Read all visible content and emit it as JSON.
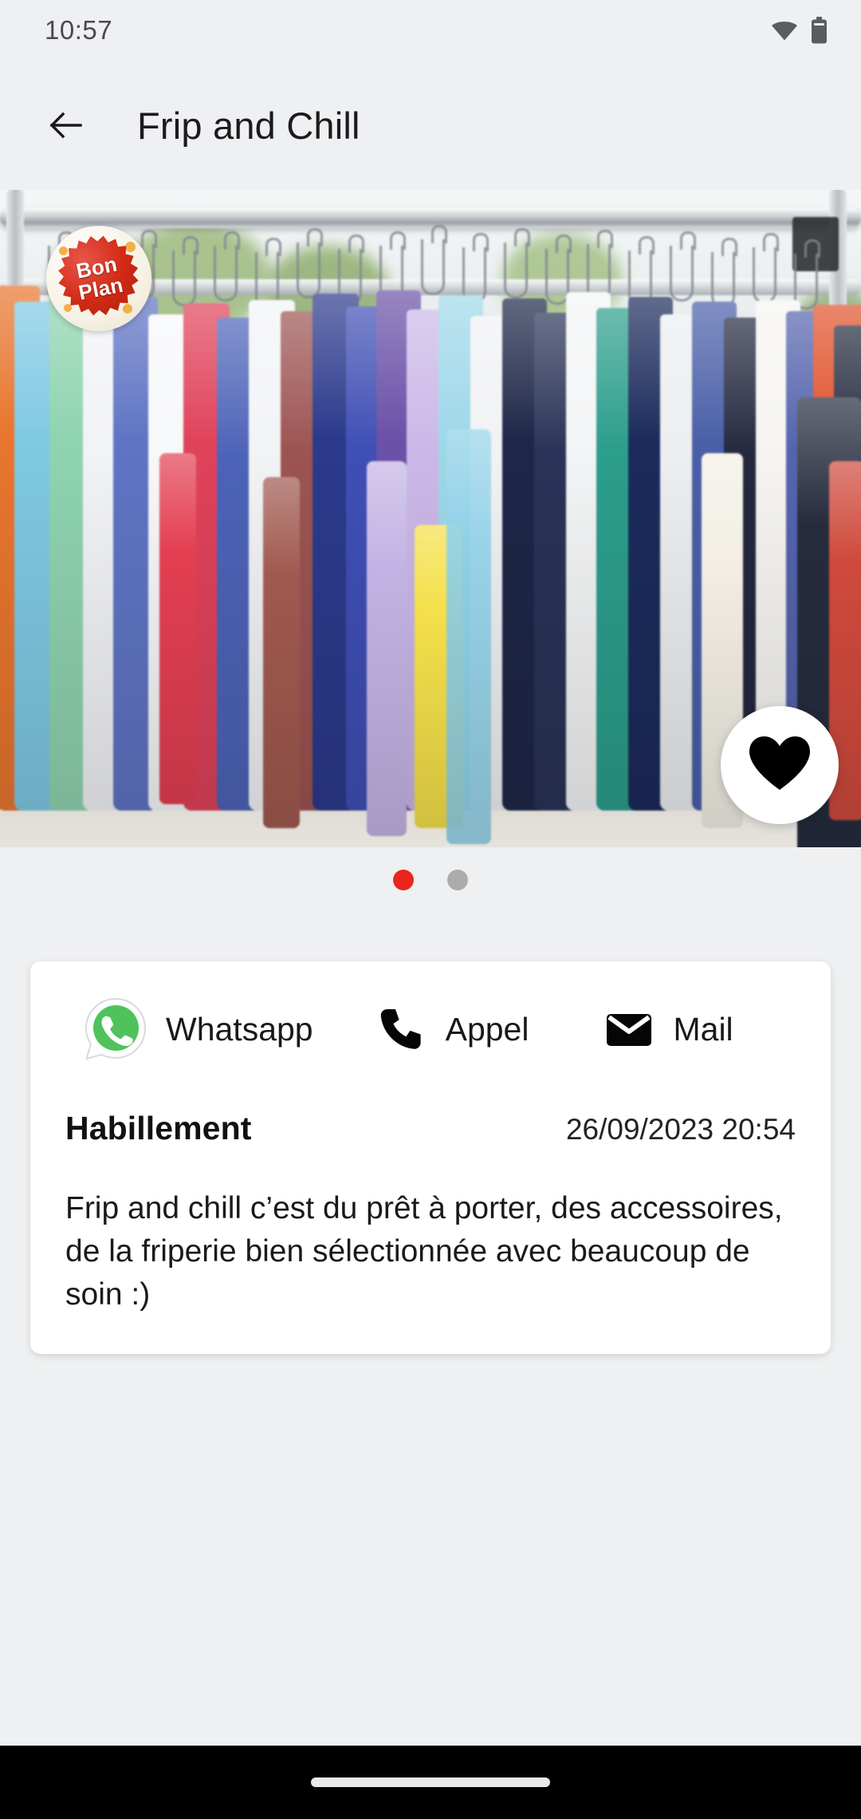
{
  "status_bar": {
    "time": "10:57",
    "icons": [
      "wifi-icon",
      "battery-icon"
    ]
  },
  "app_bar": {
    "back_icon": "arrow-left-icon",
    "title": "Frip and Chill"
  },
  "hero": {
    "alt": "Rack of colorful second-hand clothing on hangers",
    "badge": {
      "line1": "Bon",
      "line2": "Plan",
      "color": "#D22B16"
    },
    "favorite": {
      "icon": "heart-icon",
      "active": true,
      "color": "#000000"
    },
    "carousel": {
      "count": 2,
      "active_index": 0,
      "active_color": "#E8261B",
      "inactive_color": "#ACACAC"
    }
  },
  "info_card": {
    "contacts": [
      {
        "icon": "whatsapp-icon",
        "label": "Whatsapp"
      },
      {
        "icon": "phone-icon",
        "label": "Appel"
      },
      {
        "icon": "mail-icon",
        "label": "Mail"
      }
    ],
    "category": "Habillement",
    "date": "26/09/2023 20:54",
    "description": "Frip and chill c’est du prêt à porter, des accessoires, de la friperie bien sélectionnée avec beaucoup de soin :)"
  },
  "nav_bar": {
    "gesture_pill": "home-indicator"
  },
  "theme": {
    "background": "#EFF0F1",
    "card": "#FFFFFF",
    "accent": "#E8261B",
    "text": "#19191B",
    "nav_background": "#000000"
  }
}
